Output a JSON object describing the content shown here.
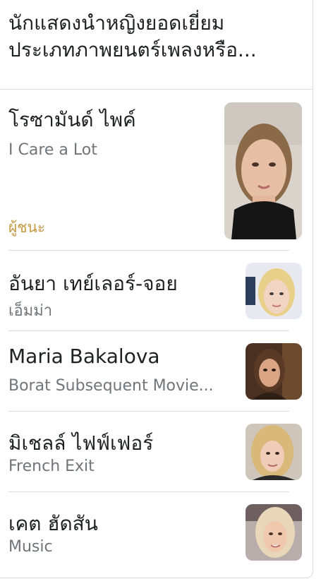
{
  "header": {
    "line1": "นักแสดงนำหญิงยอดเยี่ยม",
    "line2": "ประเภทภาพยนตร์เพลงหรือ..."
  },
  "nominees": [
    {
      "name": "โรซามันด์ ไพค์",
      "film": "I Care a Lot",
      "badge": "ผู้ชนะ",
      "photo": "portrait-rosamund-pike"
    },
    {
      "name": "อันยา เทย์เลอร์-จอย",
      "film": "เอ็มม่า",
      "photo": "portrait-anya-taylor-joy"
    },
    {
      "name": "Maria Bakalova",
      "film": "Borat Subsequent Movie...",
      "photo": "portrait-maria-bakalova"
    },
    {
      "name": "มิเชลล์ ไฟฟ์เฟอร์",
      "film": "French Exit",
      "photo": "portrait-michelle-pfeiffer"
    },
    {
      "name": "เคต ฮัดสัน",
      "film": "Music",
      "photo": "portrait-kate-hudson"
    }
  ],
  "colors": {
    "winner_badge": "#c59a43",
    "primary_text": "#202124",
    "secondary_text": "#70757a",
    "divider": "#dadce0"
  }
}
